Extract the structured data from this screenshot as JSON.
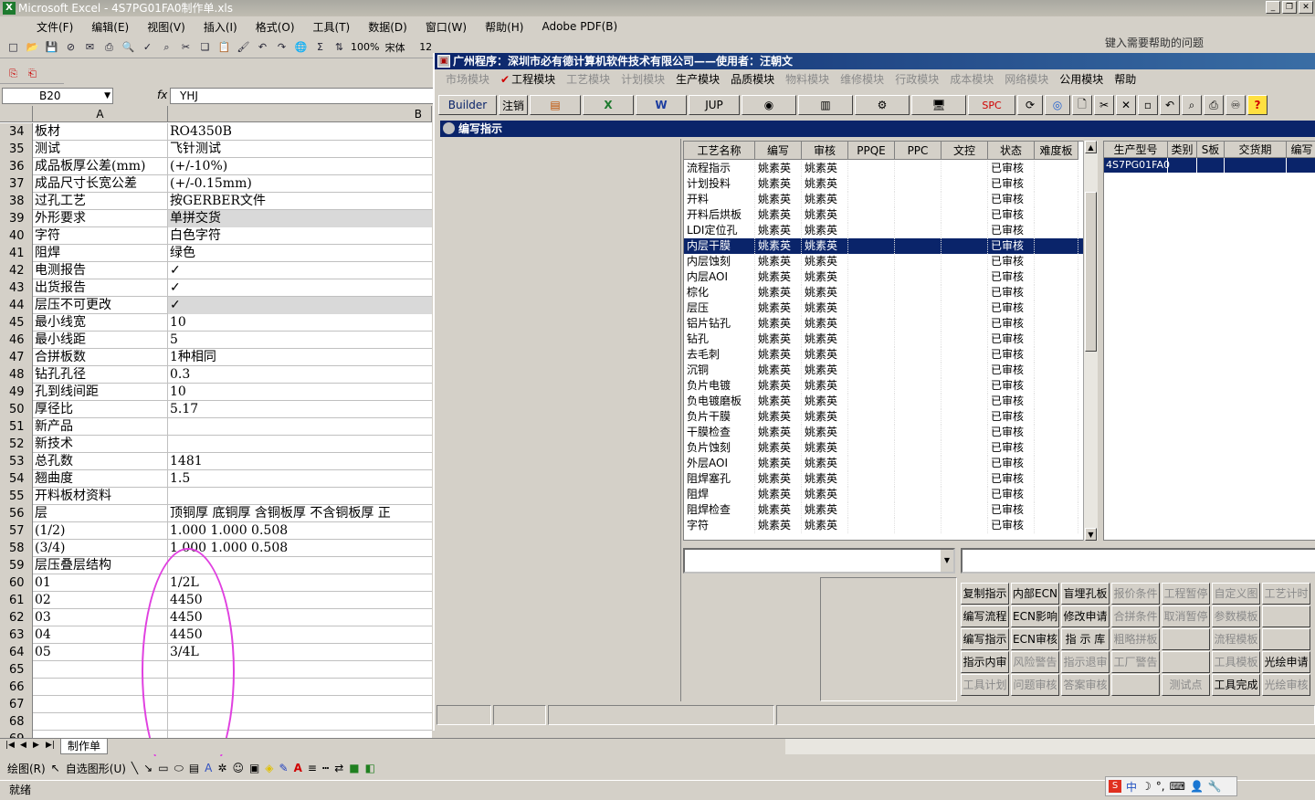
{
  "excel": {
    "title": "Microsoft Excel - 4S7PG01FA0制作单.xls",
    "menu": [
      "文件(F)",
      "编辑(E)",
      "视图(V)",
      "插入(I)",
      "格式(O)",
      "工具(T)",
      "数据(D)",
      "窗口(W)",
      "帮助(H)",
      "Adobe PDF(B)"
    ],
    "help_placeholder": "键入需要帮助的问题",
    "toolbar": {
      "zoom": "100%",
      "font": "宋体",
      "size": "12"
    },
    "name_box": "B20",
    "fx": "fx",
    "formula": "YHJ",
    "col_a": "A",
    "col_b": "B",
    "rows": [
      {
        "n": "34",
        "a": "板材",
        "b": "RO4350B"
      },
      {
        "n": "35",
        "a": "测试",
        "b": "飞针测试"
      },
      {
        "n": "36",
        "a": "成品板厚公差(mm)",
        "b": "(+/-10%)"
      },
      {
        "n": "37",
        "a": "成品尺寸长宽公差",
        "b": "(+/-0.15mm)"
      },
      {
        "n": "38",
        "a": "过孔工艺",
        "b": "按GERBER文件"
      },
      {
        "n": "39",
        "a": "外形要求",
        "b": "单拼交货",
        "gray": true
      },
      {
        "n": "40",
        "a": "字符",
        "b": "白色字符"
      },
      {
        "n": "41",
        "a": "阻焊",
        "b": "绿色"
      },
      {
        "n": "42",
        "a": "电测报告",
        "b": "✓"
      },
      {
        "n": "43",
        "a": "出货报告",
        "b": "✓"
      },
      {
        "n": "44",
        "a": "层压不可更改",
        "b": "✓",
        "gray": true
      },
      {
        "n": "45",
        "a": "最小线宽",
        "b": "10"
      },
      {
        "n": "46",
        "a": "最小线距",
        "b": "5"
      },
      {
        "n": "47",
        "a": "合拼板数",
        "b": "1种相同"
      },
      {
        "n": "48",
        "a": "钻孔孔径",
        "b": "0.3"
      },
      {
        "n": "49",
        "a": "孔到线间距",
        "b": "10"
      },
      {
        "n": "50",
        "a": "厚径比",
        "b": "5.17"
      },
      {
        "n": "51",
        "a": "新产品",
        "b": ""
      },
      {
        "n": "52",
        "a": "新技术",
        "b": ""
      },
      {
        "n": "53",
        "a": "总孔数",
        "b": "1481"
      },
      {
        "n": "54",
        "a": "翘曲度",
        "b": "1.5"
      },
      {
        "n": "55",
        "a": "开料板材资料",
        "b": ""
      },
      {
        "n": "56",
        "a": "层",
        "b": "顶铜厚  底铜厚  含铜板厚  不含铜板厚  正"
      },
      {
        "n": "57",
        "a": "(1/2)",
        "b": "1.000   1.000            0.508"
      },
      {
        "n": "58",
        "a": "(3/4)",
        "b": "1.000   1.000            0.508"
      },
      {
        "n": "59",
        "a": "层压叠层结构",
        "b": ""
      },
      {
        "n": "60",
        "a": "01",
        "b": "1/2L"
      },
      {
        "n": "61",
        "a": "02",
        "b": "4450"
      },
      {
        "n": "62",
        "a": "03",
        "b": "4450"
      },
      {
        "n": "63",
        "a": "04",
        "b": "4450"
      },
      {
        "n": "64",
        "a": "05",
        "b": "3/4L"
      },
      {
        "n": "65",
        "a": "",
        "b": ""
      },
      {
        "n": "66",
        "a": "",
        "b": ""
      },
      {
        "n": "67",
        "a": "",
        "b": ""
      },
      {
        "n": "68",
        "a": "",
        "b": ""
      },
      {
        "n": "69",
        "a": "",
        "b": ""
      }
    ],
    "sheet_tab": "制作单",
    "draw_label": "绘图(R)",
    "autoshape_label": "自选图形(U)",
    "status": "就绪",
    "ime_text": "中"
  },
  "erp": {
    "title": "广州程序：深圳市必有德计算机软件技术有限公司——使用者：汪朝文",
    "menu": [
      {
        "label": "市场模块",
        "dis": true
      },
      {
        "label": "工程模块",
        "dis": false,
        "checked": true
      },
      {
        "label": "工艺模块",
        "dis": true
      },
      {
        "label": "计划模块",
        "dis": true
      },
      {
        "label": "生产模块",
        "dis": false
      },
      {
        "label": "品质模块",
        "dis": false
      },
      {
        "label": "物料模块",
        "dis": true
      },
      {
        "label": "维修模块",
        "dis": true
      },
      {
        "label": "行政模块",
        "dis": true
      },
      {
        "label": "成本模块",
        "dis": true
      },
      {
        "label": "网络模块",
        "dis": true
      },
      {
        "label": "公用模块",
        "dis": false
      },
      {
        "label": "帮助",
        "dis": false
      }
    ],
    "tools": {
      "builder": "Builder",
      "logout": "注销",
      "jup": "JUP",
      "spc": "SPC"
    },
    "subwin_title": "编写指示",
    "process_headers": [
      "工艺名称",
      "编写",
      "审核",
      "PPQE",
      "PPC",
      "文控",
      "状态",
      "难度板"
    ],
    "process_rows": [
      [
        "流程指示",
        "姚素英",
        "姚素英",
        "已审核"
      ],
      [
        "计划投料",
        "姚素英",
        "姚素英",
        "已审核"
      ],
      [
        "开料",
        "姚素英",
        "姚素英",
        "已审核"
      ],
      [
        "开料后烘板",
        "姚素英",
        "姚素英",
        "已审核"
      ],
      [
        "LDI定位孔",
        "姚素英",
        "姚素英",
        "已审核"
      ],
      [
        "内层干膜",
        "姚素英",
        "姚素英",
        "已审核"
      ],
      [
        "内层蚀刻",
        "姚素英",
        "姚素英",
        "已审核"
      ],
      [
        "内层AOI",
        "姚素英",
        "姚素英",
        "已审核"
      ],
      [
        "棕化",
        "姚素英",
        "姚素英",
        "已审核"
      ],
      [
        "层压",
        "姚素英",
        "姚素英",
        "已审核"
      ],
      [
        "铝片钻孔",
        "姚素英",
        "姚素英",
        "已审核"
      ],
      [
        "钻孔",
        "姚素英",
        "姚素英",
        "已审核"
      ],
      [
        "去毛刺",
        "姚素英",
        "姚素英",
        "已审核"
      ],
      [
        "沉铜",
        "姚素英",
        "姚素英",
        "已审核"
      ],
      [
        "负片电镀",
        "姚素英",
        "姚素英",
        "已审核"
      ],
      [
        "负电镀磨板",
        "姚素英",
        "姚素英",
        "已审核"
      ],
      [
        "负片干膜",
        "姚素英",
        "姚素英",
        "已审核"
      ],
      [
        "干膜检查",
        "姚素英",
        "姚素英",
        "已审核"
      ],
      [
        "负片蚀刻",
        "姚素英",
        "姚素英",
        "已审核"
      ],
      [
        "外层AOI",
        "姚素英",
        "姚素英",
        "已审核"
      ],
      [
        "阻焊塞孔",
        "姚素英",
        "姚素英",
        "已审核"
      ],
      [
        "阻焊",
        "姚素英",
        "姚素英",
        "已审核"
      ],
      [
        "阻焊检查",
        "姚素英",
        "姚素英",
        "已审核"
      ],
      [
        "字符",
        "姚素英",
        "姚素英",
        "已审核"
      ]
    ],
    "model_headers": [
      "生产型号",
      "类别",
      "S板",
      "交货期",
      "编写"
    ],
    "model_row": "4S7PG01FA0",
    "buttons": [
      [
        {
          "l": "复制指示"
        },
        {
          "l": "内部ECN"
        },
        {
          "l": "盲埋孔板"
        },
        {
          "l": "报价条件",
          "dis": true
        },
        {
          "l": "工程暂停",
          "dis": true
        },
        {
          "l": "自定义图",
          "dis": true
        },
        {
          "l": "工艺计时",
          "dis": true
        }
      ],
      [
        {
          "l": "编写流程"
        },
        {
          "l": "ECN影响"
        },
        {
          "l": "修改申请"
        },
        {
          "l": "合拼条件",
          "dis": true
        },
        {
          "l": "取消暂停",
          "dis": true
        },
        {
          "l": "参数模板",
          "dis": true
        },
        {
          "l": ""
        }
      ],
      [
        {
          "l": "编写指示"
        },
        {
          "l": "ECN审核"
        },
        {
          "l": "指 示 库"
        },
        {
          "l": "粗略拼板",
          "dis": true
        },
        {
          "l": ""
        },
        {
          "l": "流程模板",
          "dis": true
        },
        {
          "l": ""
        }
      ],
      [
        {
          "l": "指示内审"
        },
        {
          "l": "风险警告",
          "dis": true
        },
        {
          "l": "指示退审",
          "dis": true
        },
        {
          "l": "工厂警告",
          "dis": true
        },
        {
          "l": ""
        },
        {
          "l": "工具模板",
          "dis": true
        },
        {
          "l": "光绘申请"
        }
      ],
      [
        {
          "l": "工具计划",
          "dis": true
        },
        {
          "l": "问题审核",
          "dis": true
        },
        {
          "l": "答案审核",
          "dis": true
        },
        {
          "l": ""
        },
        {
          "l": "测试点",
          "dis": true
        },
        {
          "l": "工具完成"
        },
        {
          "l": "光绘审核",
          "dis": true
        }
      ]
    ]
  }
}
